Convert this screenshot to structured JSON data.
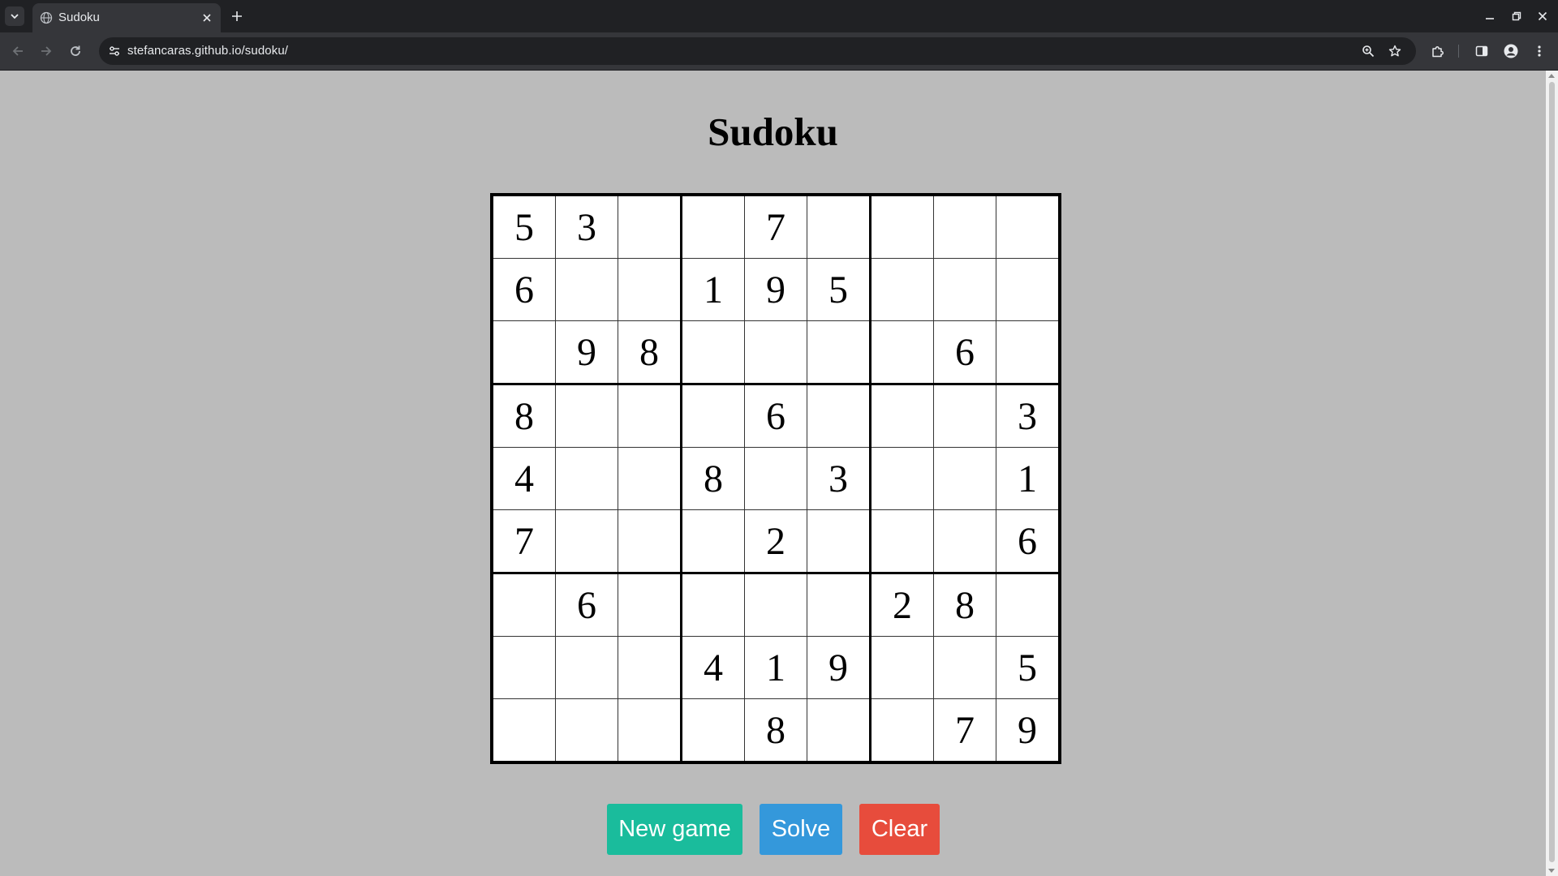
{
  "browser": {
    "tab_title": "Sudoku",
    "url": "stefancaras.github.io/sudoku/",
    "icons": {
      "tab_search": "chevron-down-icon",
      "favicon": "globe-icon",
      "tab_close": "close-icon",
      "new_tab": "plus-icon",
      "back": "back-arrow-icon",
      "forward": "forward-arrow-icon",
      "reload": "reload-icon",
      "site_info": "tune-icon",
      "zoom": "zoom-icon",
      "bookmark": "star-icon",
      "extensions": "puzzle-icon",
      "side_panel": "side-panel-icon",
      "profile": "profile-icon",
      "menu": "kebab-menu-icon",
      "minimize": "minimize-icon",
      "restore": "restore-icon",
      "close_window": "close-icon"
    }
  },
  "page": {
    "title": "Sudoku",
    "board": [
      [
        "5",
        "3",
        "",
        "",
        "7",
        "",
        "",
        "",
        ""
      ],
      [
        "6",
        "",
        "",
        "1",
        "9",
        "5",
        "",
        "",
        ""
      ],
      [
        "",
        "9",
        "8",
        "",
        "",
        "",
        "",
        "6",
        ""
      ],
      [
        "8",
        "",
        "",
        "",
        "6",
        "",
        "",
        "",
        "3"
      ],
      [
        "4",
        "",
        "",
        "8",
        "",
        "3",
        "",
        "",
        "1"
      ],
      [
        "7",
        "",
        "",
        "",
        "2",
        "",
        "",
        "",
        "6"
      ],
      [
        "",
        "6",
        "",
        "",
        "",
        "",
        "2",
        "8",
        ""
      ],
      [
        "",
        "",
        "",
        "4",
        "1",
        "9",
        "",
        "",
        "5"
      ],
      [
        "",
        "",
        "",
        "",
        "8",
        "",
        "",
        "7",
        "9"
      ]
    ],
    "buttons": {
      "new_game": "New game",
      "solve": "Solve",
      "clear": "Clear"
    },
    "colors": {
      "background": "#bbbbbb",
      "new_game": "#1abc9c",
      "solve": "#3498db",
      "clear": "#e74c3c"
    }
  }
}
